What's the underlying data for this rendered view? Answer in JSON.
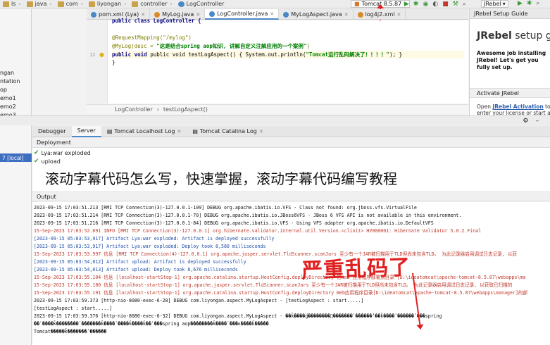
{
  "breadcrumb": [
    "ls",
    "java",
    "com",
    "liyongan",
    "controller",
    "LogController"
  ],
  "toolbar": {
    "run_config": "Tomcat 8.5.87",
    "jrebel_select": "JRebel"
  },
  "project_tree": [
    "ngan",
    "ntation",
    "op",
    "emo1",
    "emo2",
    "emo3"
  ],
  "editor_tabs": [
    {
      "label": "pom.xml (Lya)",
      "color": "#4a88c7"
    },
    {
      "label": "MyLog.java",
      "color": "#d98b2b"
    },
    {
      "label": "LogController.java",
      "color": "#4a88c7"
    },
    {
      "label": "MyLogAspect.java",
      "color": "#4a88c7"
    },
    {
      "label": "log4j2.xml",
      "color": "#d98b2b"
    }
  ],
  "code": {
    "line_numbers": [
      "",
      "",
      "",
      "",
      "12",
      "",
      ""
    ],
    "class_line": "public class LogController {",
    "mapping": "@RequestMapping(\"/mylog\")",
    "mylog_prefix": "@MyLog(desc = ",
    "mylog_string": "\"这是结合spring aop知识, 讲解自定义注解应用的一个案例\"",
    "mylog_suffix": ")",
    "method_prefix": "public void testLogAspect() { System.out.println(",
    "method_string": "\"Tomcat运行乱码解决了！！！！\"",
    "method_suffix": "); }",
    "close": "}"
  },
  "editor_breadcrumb": [
    "LogController",
    "testLogAspect()"
  ],
  "jrebel": {
    "panel_title": "JRebel Setup Guide",
    "logo_bold": "JRebel",
    "logo_light": "setup guide",
    "message": "Awesome job installing JRebel! Let's get you fully set up.",
    "activate_title": "Activate JRebel",
    "activate_prefix": "Open ",
    "activate_link": "JRebel Activation",
    "activate_suffix": " to enter your license or start a new trial"
  },
  "services": {
    "selected_node": "7 [local]",
    "tabs": [
      "Debugger",
      "Server",
      "Tomcat Localhost Log",
      "Tomcat Catalina Log"
    ],
    "deployment_label": "Deployment",
    "deployments": [
      "Lya:war exploded",
      "upload"
    ],
    "output_label": "Output"
  },
  "overlay_title": "滚动字幕代码怎么写，快速掌握，滚动字幕代码编写教程",
  "stamp_text": "严重乱码了",
  "console_lines": [
    {
      "text": "2023-09-15 17:03:51.213 [RMI TCP Connection(3)-127.0.0.1-109] DEBUG org.apache.ibatis.io.VFS - Class not found: org.jboss.vfs.VirtualFile",
      "color": "black"
    },
    {
      "text": "2023-09-15 17:03:51.214 [RMI TCP Connection(3)-127.0.0.1-70] DEBUG org.apache.ibatis.io.JBoss6VFS - JBoss 6 VFS API is not available in this environment.",
      "color": "black"
    },
    {
      "text": "2023-09-15 17:03:51.216 [RMI TCP Connection(3)-127.0.0.1-84] DEBUG org.apache.ibatis.io.VFS - Using VFS adapter org.apache.ibatis.io.DefaultVFS",
      "color": "black"
    },
    {
      "text": "15-Sep-2023 17:03:52.691 INFO [RMI TCP Connection(3)-127.0.0.1] org.hibernate.validator.internal.util.Version.<clinit> HV000001: Hibernate Validator 5.0.2.Final",
      "color": "red"
    },
    {
      "text": "[2023-09-15 05:03:53,917] Artifact Lya:war exploded: Artifact is deployed successfully",
      "color": "blue"
    },
    {
      "text": "[2023-09-15 05:03:53,917] Artifact Lya:war exploded: Deploy took 8,580 milliseconds",
      "color": "blue"
    },
    {
      "text": "15-Sep-2023 17:03:53.997 信息 [RMI TCP Connection(4)-127.0.0.1] org.apache.jasper.servlet.TldScanner.scanJars 至少有一个JAR被扫描用于TLD但尚未包含TLD。 为此记录器启用调试日志记录, 以获",
      "color": "red"
    },
    {
      "text": "[2023-09-15 05:03:54,012] Artifact upload: Artifact is deployed successfully",
      "color": "blue"
    },
    {
      "text": "[2023-09-15 05:03:54,013] Artifact upload: Deploy took 8,676 milliseconds",
      "color": "blue"
    },
    {
      "text": "15-Sep-2023 17:03:55.104 信息 [localhost-startStop-1] org.apache.catalina.startup.HostConfig.deployDirectory 把web 应用程序部署到目录 [D:\\ideatomcat\\apache-tomcat-8.5.87\\webapps\\ma",
      "color": "red"
    },
    {
      "text": "15-Sep-2023 17:03:55.180 信息 [localhost-startStop-1] org.apache.jasper.servlet.TldScanner.scanJars 至少有一个JAR被扫描用于TLD但尚未包含TLD。 为此记录器启用调试日志记录, 以获取已扫描的",
      "color": "red"
    },
    {
      "text": "15-Sep-2023 17:03:55.191 信息 [localhost-startStop-1] org.apache.catalina.startup.HostConfig.deployDirectory Web应用程序目录[D:\\ideatomcat\\apache-tomcat-8.5.87\\webapps\\manager]的部",
      "color": "red"
    },
    {
      "text": "2023-09-15 17:03:59.373 [http-nio-8080-exec-6-28] DEBUG com.liyongan.aspect.MyLogAspect - [testLogAspect : start.....]",
      "color": "black"
    },
    {
      "text": "[testLogAspect : start.....]",
      "color": "black"
    },
    {
      "text": "2023-09-15 17:03:59.376 [http-nio-8080-exec-6-32] DEBUG com.liyongan.aspect.MyLogAspect - ��ǩ����ĳ��������ͣ�������ʹ������ʼ��ǩ����ʹ������ʹ���spring",
      "color": "black"
    },
    {
      "text": "��ʹ����ǩ��������ʹ�������ǩ����ʹ����ǩ����ǩ��ʹ���spring aop��������ǩ����ʹ���ĸ����ǩ�����",
      "color": "black"
    },
    {
      "text": "Tomcat�����ǩ�������ʹ������",
      "color": "black"
    }
  ]
}
